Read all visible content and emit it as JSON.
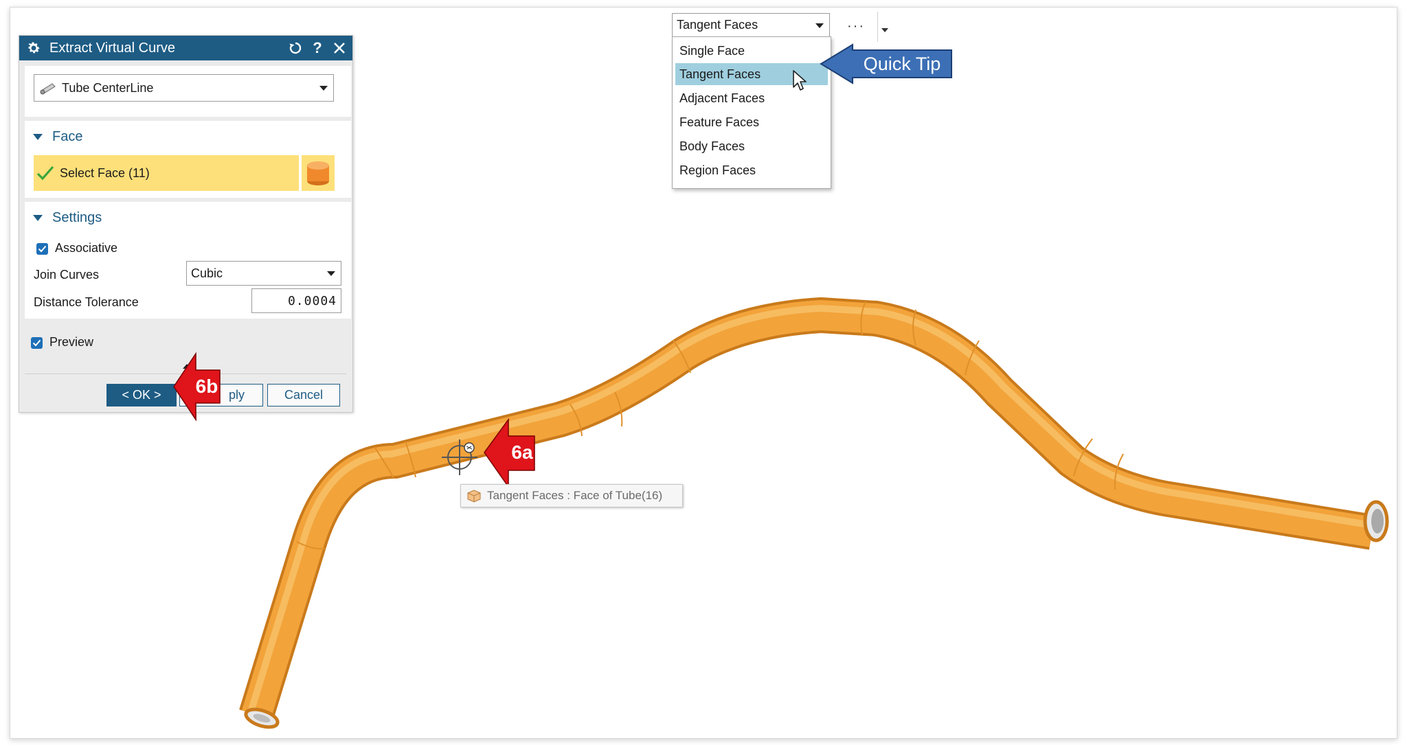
{
  "dialog": {
    "title": "Extract Virtual Curve",
    "type_value": "Tube CenterLine",
    "face_section": {
      "header": "Face",
      "select_label": "Select Face (11)"
    },
    "settings_section": {
      "header": "Settings",
      "associative_label": "Associative",
      "associative_checked": true,
      "join_curves_label": "Join Curves",
      "join_curves_value": "Cubic",
      "distance_tolerance_label": "Distance Tolerance",
      "distance_tolerance_value": "0.0004"
    },
    "preview_label": "Preview",
    "preview_checked": true,
    "ok_label": "< OK >",
    "apply_label": "Apply",
    "apply_visible_text": "ply",
    "cancel_label": "Cancel"
  },
  "selection_filter": {
    "current": "Tangent Faces",
    "more_label": "···",
    "options": [
      "Single Face",
      "Tangent Faces",
      "Adjacent Faces",
      "Feature Faces",
      "Body Faces",
      "Region Faces"
    ],
    "highlighted": "Tangent Faces"
  },
  "annotations": {
    "quick_tip": "Quick Tip",
    "step_6a": "6a",
    "step_6b": "6b"
  },
  "tooltip": {
    "text": "Tangent Faces : Face of Tube(16)"
  },
  "colors": {
    "title_bar": "#1e5c84",
    "tube": "#f2a33a",
    "select_highlight": "#fde07a",
    "dropdown_selected": "#9fcfdf",
    "callout_red": "#e0141b",
    "quick_tip_blue": "#3c6fb5",
    "checkbox": "#1e6fb8"
  }
}
